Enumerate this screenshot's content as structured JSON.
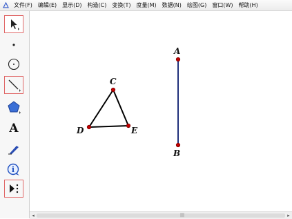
{
  "menu": {
    "items": [
      {
        "label": "文件(F)"
      },
      {
        "label": "编辑(E)"
      },
      {
        "label": "显示(D)"
      },
      {
        "label": "构造(C)"
      },
      {
        "label": "变换(T)"
      },
      {
        "label": "度量(M)"
      },
      {
        "label": "数据(N)"
      },
      {
        "label": "绘图(G)"
      },
      {
        "label": "窗口(W)"
      },
      {
        "label": "帮助(H)"
      }
    ]
  },
  "toolbox": {
    "tools": [
      {
        "icon": "arrow-select-icon"
      },
      {
        "icon": "point-tool-icon"
      },
      {
        "icon": "compass-tool-icon"
      },
      {
        "icon": "straightedge-tool-icon"
      },
      {
        "icon": "polygon-tool-icon"
      },
      {
        "icon": "text-tool-icon",
        "glyph": "A"
      },
      {
        "icon": "marker-tool-icon"
      },
      {
        "icon": "information-tool-icon",
        "glyph": "i"
      },
      {
        "icon": "custom-tool-icon"
      }
    ]
  },
  "canvas": {
    "points": {
      "A": "A",
      "B": "B",
      "C": "C",
      "D": "D",
      "E": "E"
    },
    "segment_color": "#1f2f7a",
    "triangle_color": "#000000",
    "point_color": "#c00000"
  },
  "scrollbar": {
    "left_arrow": "◂",
    "right_arrow": "▸",
    "grip": "|||"
  }
}
